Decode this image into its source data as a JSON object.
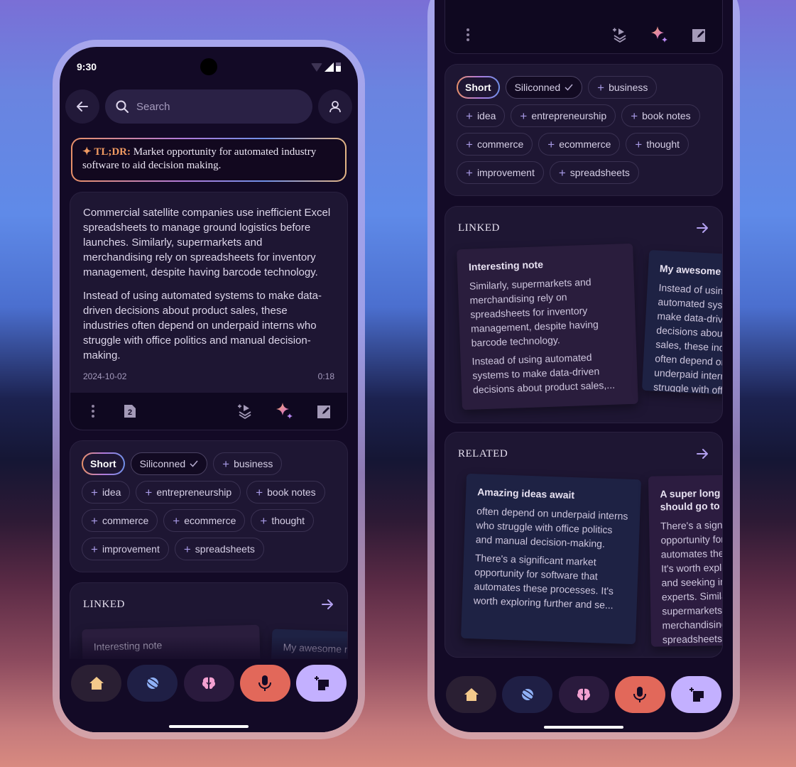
{
  "status_bar": {
    "time": "9:30"
  },
  "search": {
    "placeholder": "Search"
  },
  "tldr": {
    "label": "TL;DR:",
    "text": "Market opportunity for automated industry software to aid decision making."
  },
  "note": {
    "paragraphs": [
      "Commercial satellite companies use inefficient Excel spreadsheets to manage ground logistics before launches. Similarly, supermarkets and merchandising rely on spreadsheets for inventory management, despite having barcode technology.",
      "Instead of using automated systems to make data-driven decisions about product sales, these industries often depend on underpaid interns who struggle with office politics and manual decision-making."
    ],
    "date": "2024-10-02",
    "duration": "0:18",
    "page_badge": "2"
  },
  "tags": {
    "short_label": "Short",
    "selected_label": "Siliconned",
    "suggestions": [
      "business",
      "idea",
      "entrepreneurship",
      "book notes",
      "commerce",
      "ecommerce",
      "thought",
      "improvement",
      "spreadsheets"
    ]
  },
  "linked": {
    "title": "LINKED",
    "cards": [
      {
        "title": "Interesting note",
        "paragraphs": [
          "Similarly, supermarkets and merchandising rely on spreadsheets for inventory management, despite having barcode technology.",
          "Instead of using automated systems to make data-driven decisions about product sales,..."
        ]
      },
      {
        "title": "My awesome note",
        "paragraphs": [
          "Instead of using automated systems to make data-driven decisions about product sales, these industries often depend on underpaid interns who struggle with office politics and manual decision-making."
        ]
      }
    ]
  },
  "related": {
    "title": "RELATED",
    "cards": [
      {
        "title": "Amazing ideas await",
        "paragraphs": [
          "often depend on underpaid interns who struggle with office politics and manual decision-making.",
          "There's a significant market opportunity for software that automates these processes. It's worth exploring further and se..."
        ]
      },
      {
        "title": "A super long note title that should go to the next line",
        "paragraphs": [
          "There's a significant market opportunity for software that automates these processes. It's worth exploring further and seeking input from experts. Similarly, supermarkets and merchandising rely on spreadsheets for inventory"
        ]
      }
    ]
  },
  "nav": {
    "items": [
      {
        "name": "home",
        "icon": "home-icon",
        "bg": "#2a1f33",
        "color": "#f3c98b"
      },
      {
        "name": "explore",
        "icon": "planet-icon",
        "bg": "#1f1f45",
        "color": "#8fb0f5"
      },
      {
        "name": "brain",
        "icon": "brain-icon",
        "bg": "#2a1a3d",
        "color": "#f2a0d0"
      },
      {
        "name": "record",
        "icon": "microphone-icon",
        "bg": "#e2685a",
        "color": "#130a26"
      },
      {
        "name": "new-note",
        "icon": "add-note-icon",
        "bg": "#c3b0ff",
        "color": "#130a26"
      }
    ]
  },
  "colors": {
    "accent": "#a89ae6",
    "tldr_label": "#f09a62",
    "record": "#e2685a",
    "new_note": "#c3b0ff"
  }
}
